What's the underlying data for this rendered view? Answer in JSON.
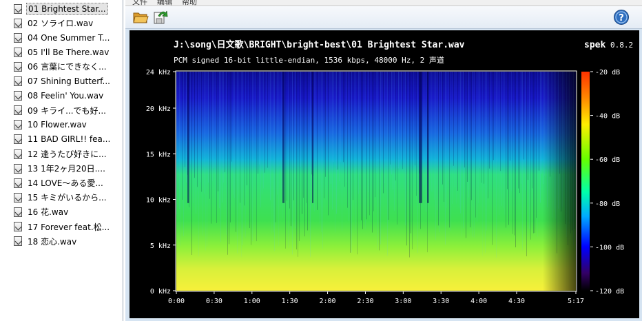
{
  "file_list": [
    {
      "label": "01 Brightest Star...",
      "selected": true
    },
    {
      "label": "02 ソライロ.wav"
    },
    {
      "label": "04 One Summer T..."
    },
    {
      "label": "05 I'll Be There.wav"
    },
    {
      "label": "06 言葉にできなく..."
    },
    {
      "label": "07 Shining Butterf..."
    },
    {
      "label": "08 Feelin' You.wav"
    },
    {
      "label": "09 キライ...でも好..."
    },
    {
      "label": "10 Flower.wav"
    },
    {
      "label": "11 BAD GIRL!! fea..."
    },
    {
      "label": "12 逢うたび好きに..."
    },
    {
      "label": "13 1年2ヶ月20日...."
    },
    {
      "label": "14 LOVE～ある愛..."
    },
    {
      "label": "15 キミがいるから..."
    },
    {
      "label": "16 花.wav"
    },
    {
      "label": "17 Forever feat.松..."
    },
    {
      "label": "18 恋心.wav"
    }
  ],
  "menu": [
    "文件",
    "编辑",
    "帮助"
  ],
  "toolbar": {
    "open_icon": "folder-open-icon",
    "save_icon": "save-export-icon",
    "help_icon": "help-icon",
    "help_label": "?"
  },
  "spectrogram": {
    "file_path": "J:\\song\\日文歌\\BRIGHT\\bright-best\\01 Brightest Star.wav",
    "app_name": "spek",
    "app_version": "0.8.2",
    "format_info": "PCM signed 16-bit little-endian, 1536 kbps, 48000 Hz, 2 声道",
    "freq_ticks": [
      {
        "value": 0,
        "label": "0 kHz"
      },
      {
        "value": 5,
        "label": "5 kHz"
      },
      {
        "value": 10,
        "label": "10 kHz"
      },
      {
        "value": 15,
        "label": "15 kHz"
      },
      {
        "value": 20,
        "label": "20 kHz"
      },
      {
        "value": 24,
        "label": "24 kHz"
      }
    ],
    "freq_max": 24,
    "time_ticks": [
      {
        "value": 0,
        "label": "0:00"
      },
      {
        "value": 30,
        "label": "0:30"
      },
      {
        "value": 60,
        "label": "1:00"
      },
      {
        "value": 90,
        "label": "1:30"
      },
      {
        "value": 120,
        "label": "2:00"
      },
      {
        "value": 150,
        "label": "2:30"
      },
      {
        "value": 180,
        "label": "3:00"
      },
      {
        "value": 210,
        "label": "3:30"
      },
      {
        "value": 240,
        "label": "4:00"
      },
      {
        "value": 270,
        "label": "4:30"
      },
      {
        "value": 317,
        "label": "5:17"
      }
    ],
    "duration_seconds": 317,
    "db_ticks": [
      {
        "value": -20,
        "label": "-20 dB"
      },
      {
        "value": -40,
        "label": "-40 dB"
      },
      {
        "value": -60,
        "label": "-60 dB"
      },
      {
        "value": -80,
        "label": "-80 dB"
      },
      {
        "value": -100,
        "label": "-100 dB"
      },
      {
        "value": -120,
        "label": "-120 dB"
      }
    ],
    "db_range": [
      -120,
      -20
    ],
    "colors": {
      "background": "#000000",
      "text": "#ffffff",
      "colorbar": [
        "#ffff99",
        "#ff0000",
        "#ff8800",
        "#ffee00",
        "#66ff00",
        "#00ffaa",
        "#00aaff",
        "#0000ff",
        "#330066",
        "#000000"
      ]
    }
  }
}
